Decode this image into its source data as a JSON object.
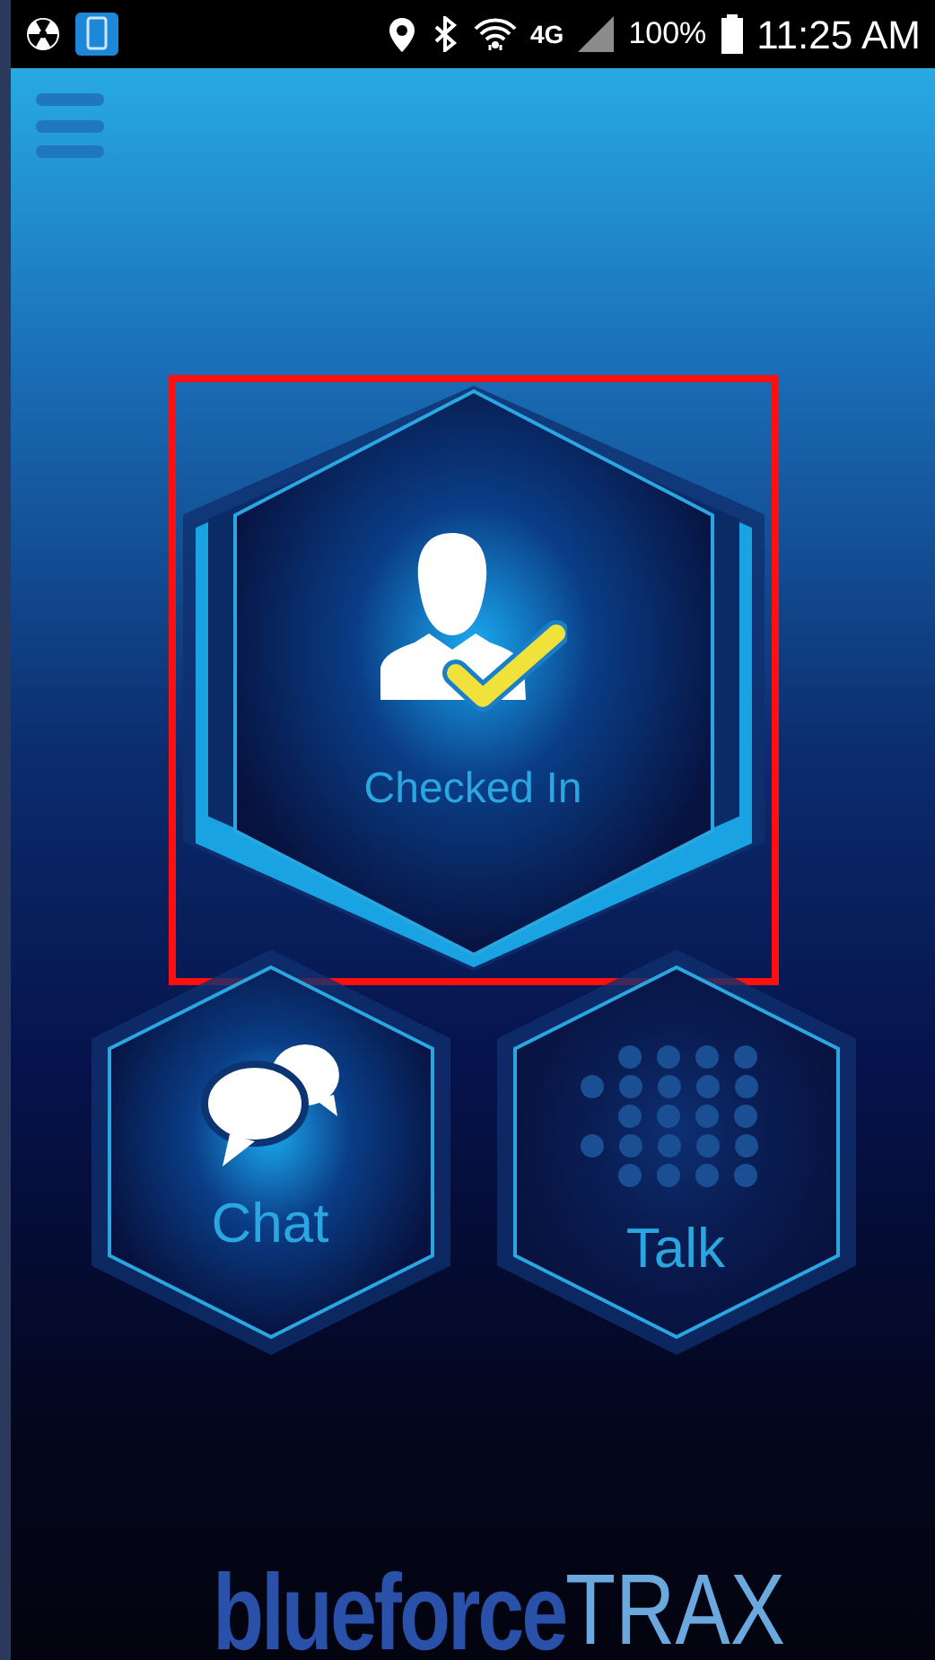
{
  "status_bar": {
    "network": "4G",
    "battery": "100%",
    "time": "11:25 AM"
  },
  "tiles": [
    {
      "kind": "checkin",
      "label": "Checked In",
      "highlighted": true
    },
    {
      "kind": "chat",
      "label": "Chat",
      "highlighted": false
    },
    {
      "kind": "talk",
      "label": "Talk",
      "highlighted": false
    }
  ],
  "logo": {
    "bold": "blueforce",
    "light": "TRAX"
  }
}
